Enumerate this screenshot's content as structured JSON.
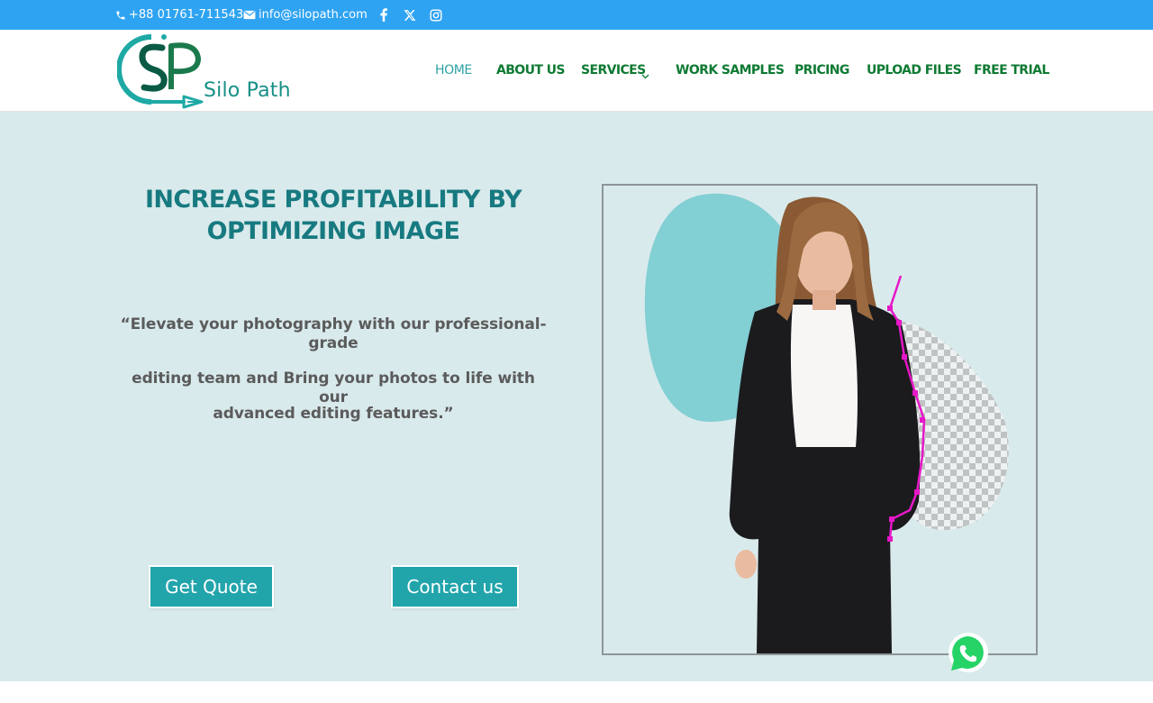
{
  "topbar": {
    "phone": "+88 01761-711543",
    "email": "info@silopath.com",
    "social": [
      "facebook-icon",
      "x-icon",
      "instagram-icon"
    ]
  },
  "brand": {
    "logo_letters": "SP",
    "logo_text": "Silo Path"
  },
  "nav": {
    "items": [
      "HOME",
      "ABOUT US",
      "SERVICES",
      "WORK SAMPLES",
      "PRICING",
      "UPLOAD FILES",
      "FREE TRIAL"
    ]
  },
  "hero": {
    "headline_line1": "INCREASE PROFITABILITY BY",
    "headline_line2": "OPTIMIZING IMAGE",
    "quote_line1": "“Elevate your photography with our professional-grade",
    "quote_line2": "editing team and  Bring your photos to life with our",
    "quote_line3": "advanced editing features.”",
    "btn_quote": "Get Quote",
    "btn_contact": "Contact us"
  },
  "colors": {
    "topbar": "#2ea3f2",
    "nav_text": "#0e7a33",
    "nav_active": "#2ea3a6",
    "hero_bg": "#d9eaec",
    "headline": "#177a80",
    "button": "#22a4ab"
  }
}
